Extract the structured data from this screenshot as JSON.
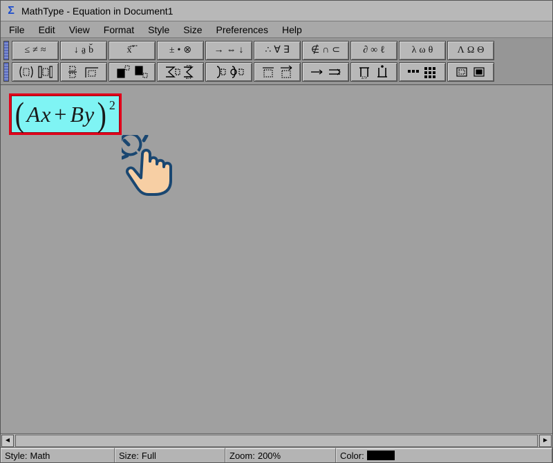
{
  "titlebar": {
    "title": "MathType - Equation in Document1"
  },
  "menu": {
    "items": [
      "File",
      "Edit",
      "View",
      "Format",
      "Style",
      "Size",
      "Preferences",
      "Help"
    ]
  },
  "toolbar": {
    "row1": [
      {
        "name": "relations",
        "glyphs": [
          "≤",
          "≠",
          "≈"
        ]
      },
      {
        "name": "spaces",
        "glyphs": [
          "↓",
          "a̱",
          "b̌",
          ":"
        ]
      },
      {
        "name": "embellish",
        "glyphs": [
          "x̄",
          "⃗",
          "⃛"
        ]
      },
      {
        "name": "operators",
        "glyphs": [
          "±",
          "•",
          "⊗"
        ]
      },
      {
        "name": "arrows",
        "glyphs": [
          "→",
          "⇔",
          "↓"
        ]
      },
      {
        "name": "logical",
        "glyphs": [
          "∴",
          "∀",
          "∃"
        ]
      },
      {
        "name": "set",
        "glyphs": [
          "∉",
          "∩",
          "⊂"
        ]
      },
      {
        "name": "misc",
        "glyphs": [
          "∂",
          "∞",
          "ℓ"
        ]
      },
      {
        "name": "greek-lower",
        "glyphs": [
          "λ",
          "ω",
          "θ"
        ]
      },
      {
        "name": "greek-upper",
        "glyphs": [
          "Λ",
          "Ω",
          "Θ"
        ]
      }
    ],
    "row2": [
      {
        "name": "fences"
      },
      {
        "name": "fractions"
      },
      {
        "name": "scripts"
      },
      {
        "name": "sums"
      },
      {
        "name": "integrals"
      },
      {
        "name": "bars"
      },
      {
        "name": "label-arrows"
      },
      {
        "name": "products"
      },
      {
        "name": "matrices"
      },
      {
        "name": "boxes"
      }
    ]
  },
  "equation": {
    "open": "(",
    "body_ax": "Ax",
    "body_op": "+",
    "body_by": "By",
    "close": ")",
    "sup": "2"
  },
  "status": {
    "style_label": "Style:",
    "style_value": "Math",
    "size_label": "Size:",
    "size_value": "Full",
    "zoom_label": "Zoom:",
    "zoom_value": "200%",
    "color_label": "Color:"
  }
}
